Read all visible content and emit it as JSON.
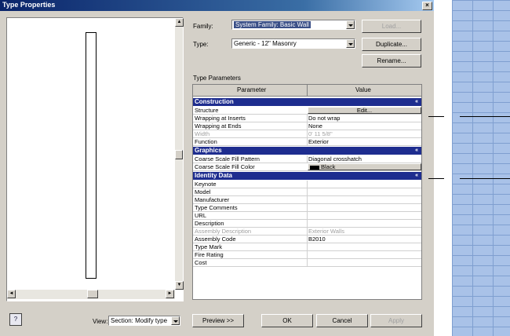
{
  "window": {
    "title": "Type Properties",
    "close_glyph": "×"
  },
  "family": {
    "label": "Family:",
    "value": "System Family: Basic Wall",
    "load_button": "Load..."
  },
  "type": {
    "label": "Type:",
    "value": "Generic - 12\" Masonry",
    "duplicate_button": "Duplicate...",
    "rename_button": "Rename..."
  },
  "type_parameters": {
    "heading": "Type Parameters",
    "col_parameter": "Parameter",
    "col_value": "Value",
    "collapse_glyph": "«",
    "groups": [
      {
        "name": "Construction",
        "rows": [
          {
            "param": "Structure",
            "value": "Edit..."
          },
          {
            "param": "Wrapping at Inserts",
            "value": "Do not wrap"
          },
          {
            "param": "Wrapping at Ends",
            "value": "None"
          },
          {
            "param": "Width",
            "value": "0' 11 5/8\""
          },
          {
            "param": "Function",
            "value": "Exterior"
          }
        ]
      },
      {
        "name": "Graphics",
        "rows": [
          {
            "param": "Coarse Scale Fill Pattern",
            "value": "Diagonal crosshatch"
          },
          {
            "param": "Coarse Scale Fill Color",
            "value": "Black"
          }
        ]
      },
      {
        "name": "Identity Data",
        "rows": [
          {
            "param": "Keynote",
            "value": ""
          },
          {
            "param": "Model",
            "value": ""
          },
          {
            "param": "Manufacturer",
            "value": ""
          },
          {
            "param": "Type Comments",
            "value": ""
          },
          {
            "param": "URL",
            "value": ""
          },
          {
            "param": "Description",
            "value": ""
          },
          {
            "param": "Assembly Description",
            "value": "Exterior Walls"
          },
          {
            "param": "Assembly Code",
            "value": "B2010"
          },
          {
            "param": "Type Mark",
            "value": ""
          },
          {
            "param": "Fire Rating",
            "value": ""
          },
          {
            "param": "Cost",
            "value": ""
          }
        ]
      }
    ]
  },
  "footer": {
    "view_label": "View:",
    "view_value": "Section: Modify type",
    "preview_button": "Preview >>",
    "ok_button": "OK",
    "cancel_button": "Cancel",
    "apply_button": "Apply"
  },
  "icons": {
    "help": "help-icon",
    "scroll_up": "▲",
    "scroll_down": "▼",
    "scroll_left": "◄",
    "scroll_right": "►"
  },
  "colors": {
    "title_bar": "#0a246a",
    "group_header": "#1e2d8f",
    "dialog_bg": "#d4d0c8",
    "brick": "#a9c2e8"
  }
}
